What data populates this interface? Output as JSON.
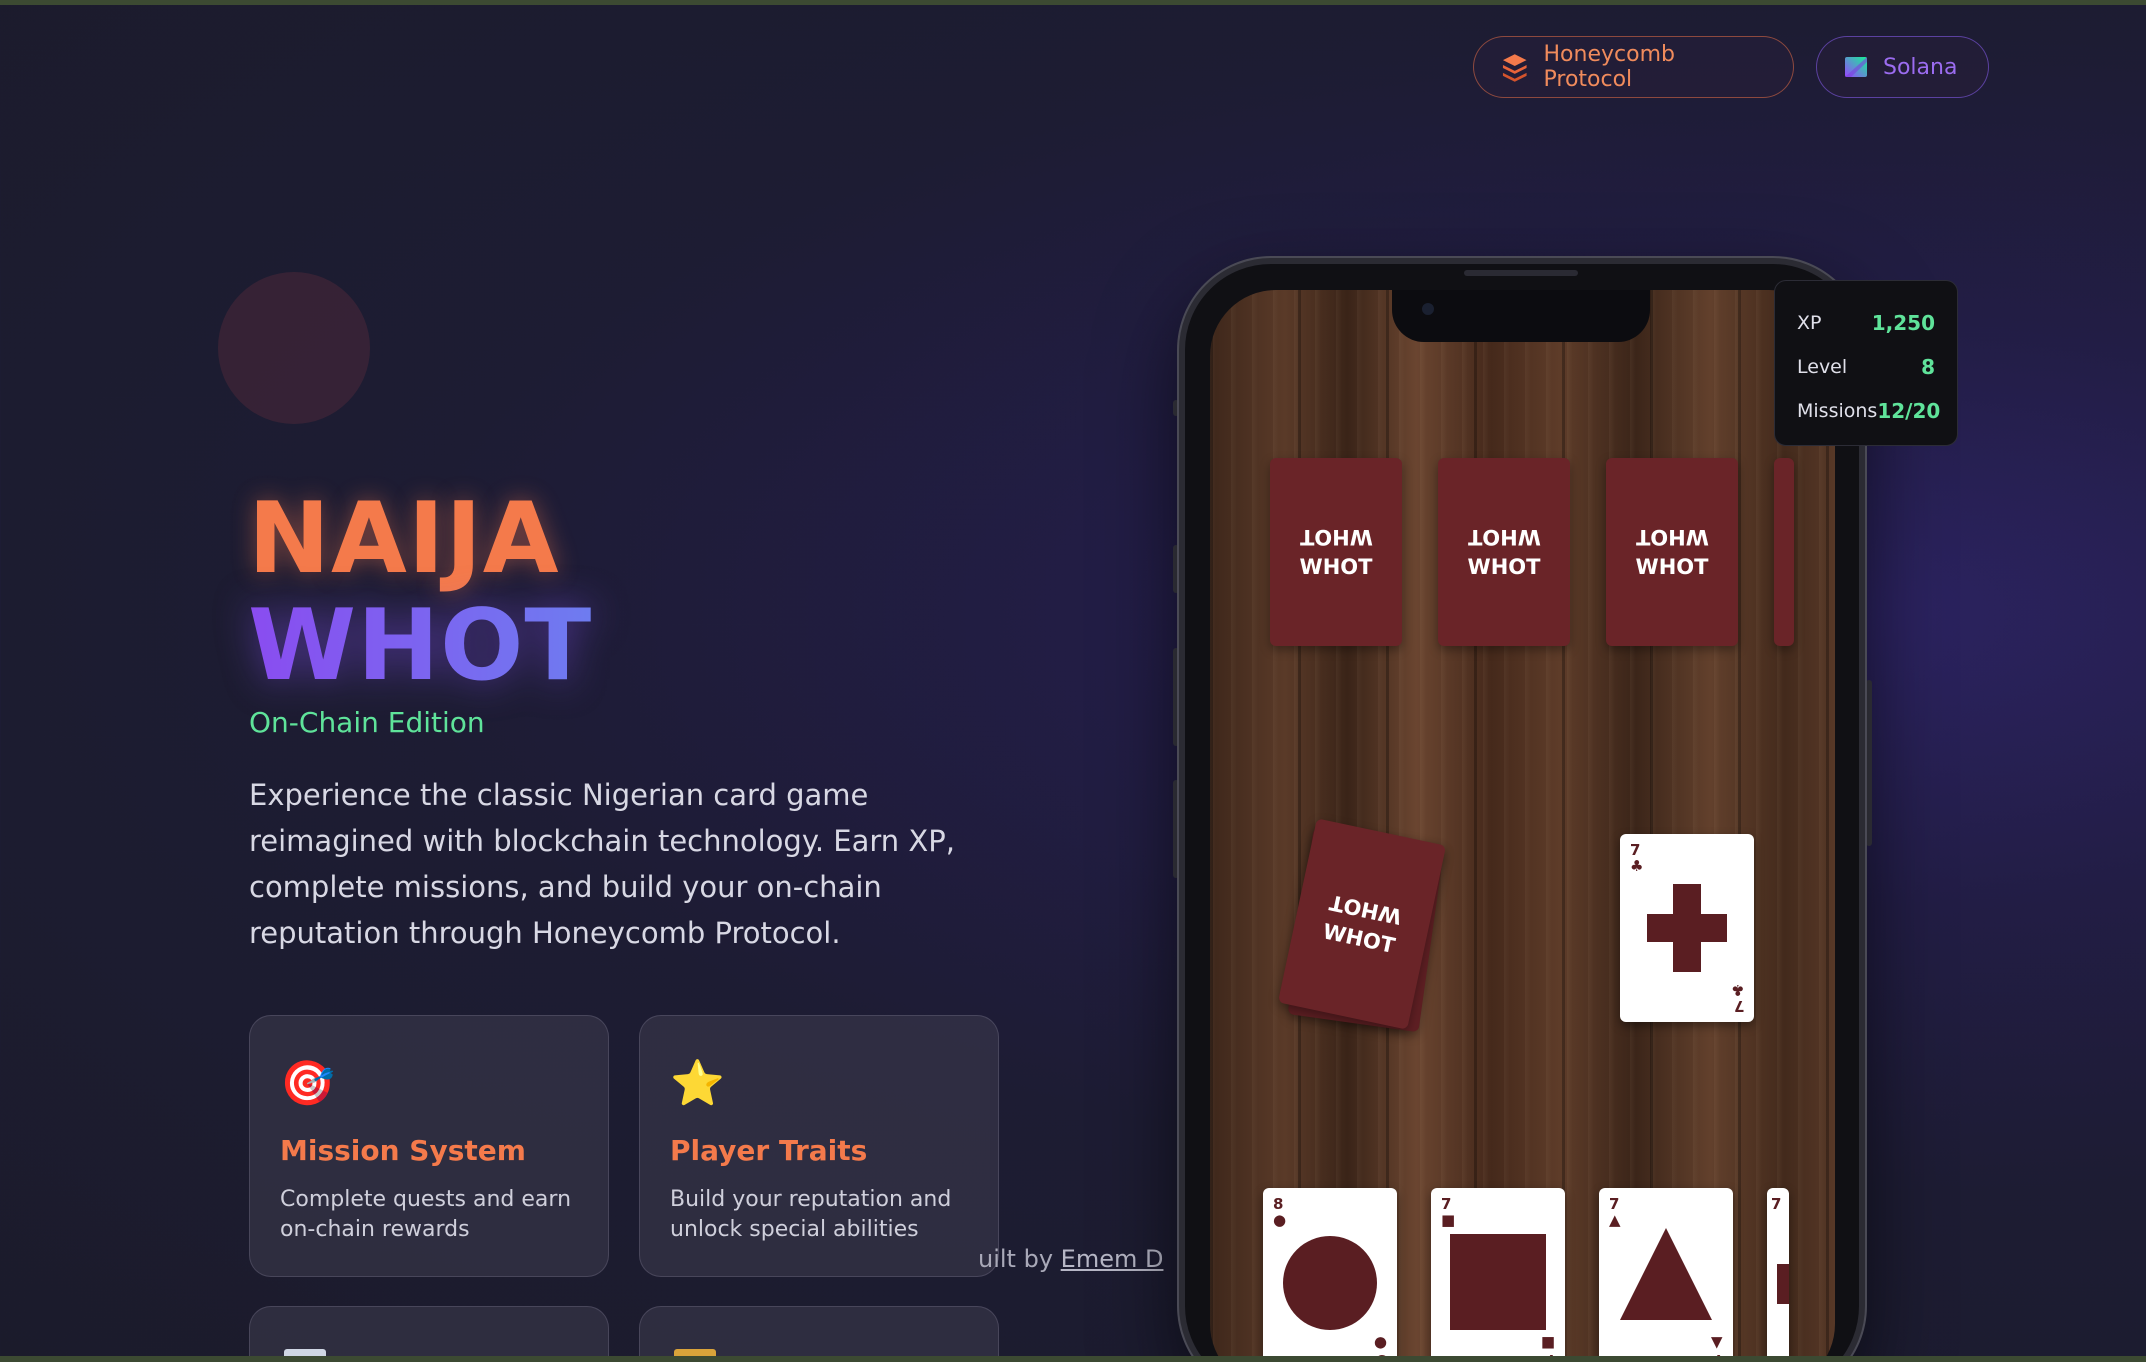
{
  "badges": {
    "honeycomb": {
      "label": "Honeycomb Protocol",
      "icon": "honeycomb-stack-icon",
      "color": "#f08b5c"
    },
    "solana": {
      "label": "Solana",
      "icon": "solana-logo-icon",
      "color": "#9b6cf0"
    }
  },
  "hero": {
    "title_line1": "NAIJA",
    "title_line2": "WHOT",
    "subtitle": "On-Chain Edition",
    "description": "Experience the classic Nigerian card game reimagined with blockchain technology. Earn XP, complete missions, and build your on-chain reputation through Honeycomb Protocol."
  },
  "features": [
    {
      "icon": "🎯",
      "icon_name": "target-icon",
      "title": "Mission System",
      "desc": "Complete quests and earn on-chain rewards"
    },
    {
      "icon": "⭐",
      "icon_name": "star-icon",
      "title": "Player Traits",
      "desc": "Build your reputation and unlock special abilities"
    }
  ],
  "footer": {
    "built_by_prefix": "uilt by",
    "built_by_name": "Emem D"
  },
  "game": {
    "card_back_text": {
      "line1": "WHOT",
      "line2": "WHOT"
    },
    "opponent_cards": 3,
    "played_card": {
      "number": "7",
      "symbol": "cross"
    },
    "hand": [
      {
        "number": "8",
        "symbol": "circle"
      },
      {
        "number": "7",
        "symbol": "square"
      },
      {
        "number": "7",
        "symbol": "triangle"
      },
      {
        "number": "7",
        "symbol": "partial"
      }
    ]
  },
  "stats": [
    {
      "label": "XP",
      "value": "1,250"
    },
    {
      "label": "Level",
      "value": "8"
    },
    {
      "label": "Missions",
      "value": "12/20"
    }
  ]
}
